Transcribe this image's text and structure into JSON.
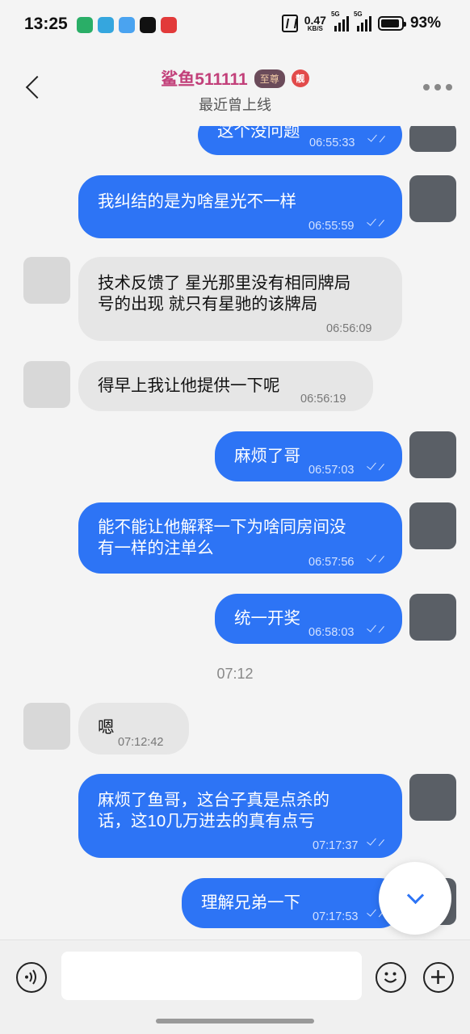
{
  "status_bar": {
    "time": "13:25",
    "net_speed": "0.47",
    "net_unit": "KB/S",
    "signal1_tag": "5G",
    "signal2_tag": "5G",
    "battery": "93%",
    "app_icons": [
      "wechat-icon",
      "telegram-icon",
      "weather-icon",
      "tiktok-icon",
      "app-red-icon"
    ]
  },
  "header": {
    "contact_name": "鲨鱼511111",
    "vip_badge": "至尊",
    "pretty_badge": "靓",
    "status": "最近曾上线"
  },
  "messages": [
    {
      "side": "out",
      "text": "这个没问题",
      "time": "06:55:33"
    },
    {
      "side": "out",
      "text": "我纠结的是为啥星光不一样",
      "time": "06:55:59"
    },
    {
      "side": "in",
      "text": "技术反馈了 星光那里没有相同牌局\n号的出现 就只有星驰的该牌局",
      "time": "06:56:09"
    },
    {
      "side": "in",
      "text": "得早上我让他提供一下呢",
      "time": "06:56:19"
    },
    {
      "side": "out",
      "text": "麻烦了哥",
      "time": "06:57:03"
    },
    {
      "side": "out",
      "text": "能不能让他解释一下为啥同房间没\n有一样的注单么",
      "time": "06:57:56"
    },
    {
      "side": "out",
      "text": "统一开奖",
      "time": "06:58:03"
    },
    {
      "side": "in",
      "text": "嗯",
      "time": "07:12:42"
    },
    {
      "side": "out",
      "text": "麻烦了鱼哥，这台子真是点杀的\n话，这10几万进去的真有点亏",
      "time": "07:17:37"
    },
    {
      "side": "out",
      "text": "理解兄弟一下",
      "time": "07:17:53"
    }
  ],
  "time_divider": "07:12",
  "input": {
    "placeholder": ""
  },
  "colors": {
    "outgoing": "#2d74f5",
    "incoming": "#e6e6e6",
    "name": "#c2407a"
  }
}
